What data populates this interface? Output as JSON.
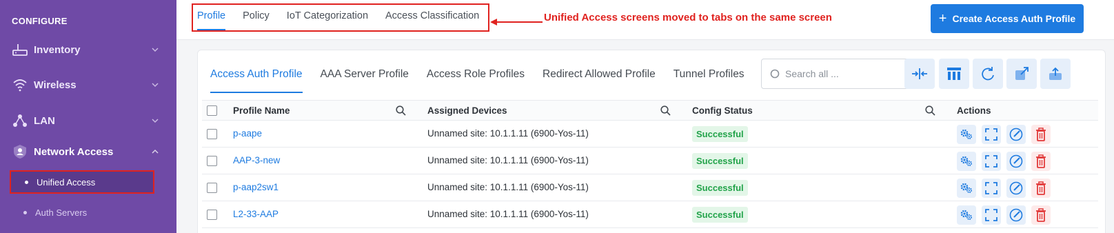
{
  "sidebar": {
    "section": "CONFIGURE",
    "items": [
      {
        "label": "Inventory",
        "icon": "router-icon"
      },
      {
        "label": "Wireless",
        "icon": "wifi-icon"
      },
      {
        "label": "LAN",
        "icon": "network-nodes-icon"
      },
      {
        "label": "Network Access",
        "icon": "user-shield-icon"
      }
    ],
    "subitems": [
      {
        "label": "Unified Access",
        "active": true
      },
      {
        "label": "Auth Servers",
        "active": false
      }
    ]
  },
  "header": {
    "tabs": [
      "Profile",
      "Policy",
      "IoT Categorization",
      "Access Classification"
    ],
    "active_tab": "Profile",
    "annotation": "Unified Access screens moved to tabs on the same screen",
    "create_button": "Create Access Auth Profile"
  },
  "card": {
    "subtabs": [
      "Access Auth Profile",
      "AAA Server Profile",
      "Access Role Profiles",
      "Redirect Allowed Profile",
      "Tunnel Profiles"
    ],
    "active_subtab": "Access Auth Profile",
    "search_placeholder": "Search all ...",
    "toolbar_icons": [
      "collapse-columns-icon",
      "table-columns-icon",
      "refresh-icon",
      "export-icon",
      "upload-icon"
    ]
  },
  "table": {
    "columns": [
      "Profile Name",
      "Assigned Devices",
      "Config Status",
      "Actions"
    ],
    "rows": [
      {
        "name": "p-aape",
        "devices": "Unnamed site: 10.1.1.11 (6900-Yos-11)",
        "status": "Successful"
      },
      {
        "name": "AAP-3-new",
        "devices": "Unnamed site: 10.1.1.11 (6900-Yos-11)",
        "status": "Successful"
      },
      {
        "name": "p-aap2sw1",
        "devices": "Unnamed site: 10.1.1.11 (6900-Yos-11)",
        "status": "Successful"
      },
      {
        "name": "L2-33-AAP",
        "devices": "Unnamed site: 10.1.1.11 (6900-Yos-11)",
        "status": "Successful"
      }
    ],
    "row_action_icons": [
      "settings-gears-icon",
      "expand-icon",
      "edit-icon",
      "delete-icon"
    ]
  },
  "colors": {
    "sidebar_bg": "#6f4aa6",
    "accent": "#1e7be0",
    "annotation": "#e0221f",
    "success": "#22a34a"
  }
}
